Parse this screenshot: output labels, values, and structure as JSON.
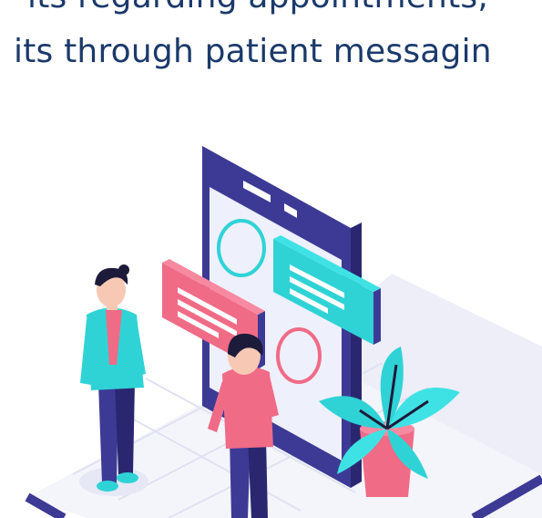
{
  "headline": {
    "line1": "its regarding appointments,",
    "line2": "its through patient messagin"
  },
  "illustration": {
    "subject": "two-people-with-phone-and-messages",
    "colors": {
      "text": "#1b3a6b",
      "device": "#3d3a96",
      "screen": "#eef0fb",
      "teal": "#2fd3d6",
      "pink": "#f06b86",
      "skin": "#f7c9b5",
      "hair": "#1d1b3a",
      "floor": "#f0f1f8"
    }
  }
}
